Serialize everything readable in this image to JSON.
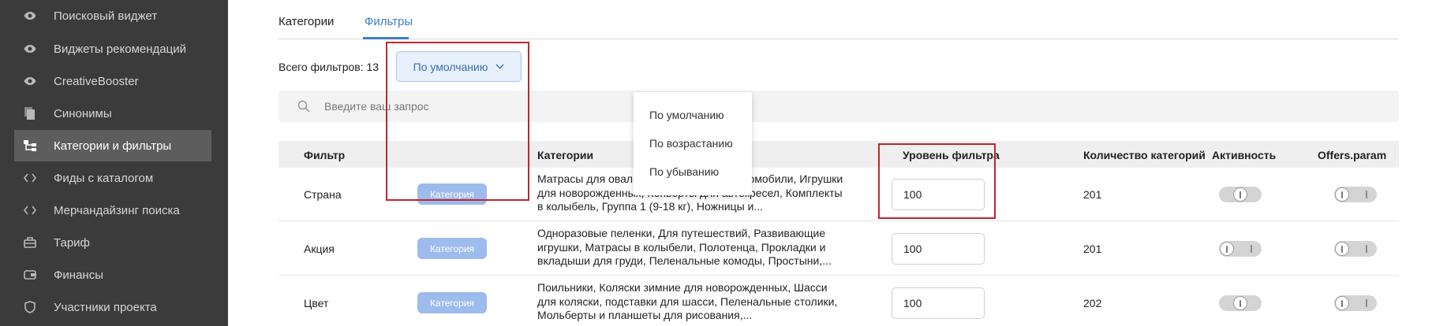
{
  "sidebar": {
    "items": [
      {
        "label": "Поисковый виджет",
        "icon": "eye-icon"
      },
      {
        "label": "Виджеты рекомендаций",
        "icon": "eye-icon"
      },
      {
        "label": "CreativeBooster",
        "icon": "eye-icon"
      },
      {
        "label": "Синонимы",
        "icon": "copy-icon"
      },
      {
        "label": "Категории и фильтры",
        "icon": "tree-icon",
        "active": true
      },
      {
        "label": "Фиды с каталогом",
        "icon": "code-icon"
      },
      {
        "label": "Мерчандайзинг поиска",
        "icon": "code-icon"
      },
      {
        "label": "Тариф",
        "icon": "briefcase-icon"
      },
      {
        "label": "Финансы",
        "icon": "wallet-icon"
      },
      {
        "label": "Участники проекта",
        "icon": "shield-icon"
      }
    ]
  },
  "tabs": {
    "categories": "Категории",
    "filters": "Фильтры"
  },
  "toolbar": {
    "total_label": "Всего фильтров: 13",
    "sort_label": "По умолчанию"
  },
  "search": {
    "placeholder": "Введите ваш запрос"
  },
  "sort_menu": {
    "items": [
      "По умолчанию",
      "По возрастанию",
      "По убыванию"
    ]
  },
  "table": {
    "headers": {
      "filter": "Фильтр",
      "categories": "Категории",
      "level": "Уровень фильтра",
      "count": "Количество категорий",
      "active": "Активность",
      "offers": "Offers.param"
    },
    "rows": [
      {
        "filter": "Страна",
        "badge": "Категория",
        "categories": "Матрасы для овальных кроваток, Электромобили, Игрушки для новорожденных, Конверты для автокресел, Комплекты в колыбель, Группа 1 (9-18 кг), Ножницы и...",
        "level": "100",
        "count": "201"
      },
      {
        "filter": "Акция",
        "badge": "Категория",
        "categories": "Одноразовые пеленки, Для путешествий, Развивающие игрушки, Матрасы в колыбели, Полотенца, Прокладки и вкладыши для груди, Пеленальные комоды, Простыни,...",
        "level": "100",
        "count": "201"
      },
      {
        "filter": "Цвет",
        "badge": "Категория",
        "categories": "Поильники, Коляски зимние для новорожденных, Шасси для коляски, подставки для шасси, Пеленальные столики, Мольберты и планшеты для рисования,...",
        "level": "100",
        "count": "202"
      }
    ]
  },
  "colors": {
    "sidebar_bg": "#3b3b3b",
    "accent": "#3d7cc9",
    "highlight": "#c0262d",
    "badge": "#9dbbec"
  }
}
